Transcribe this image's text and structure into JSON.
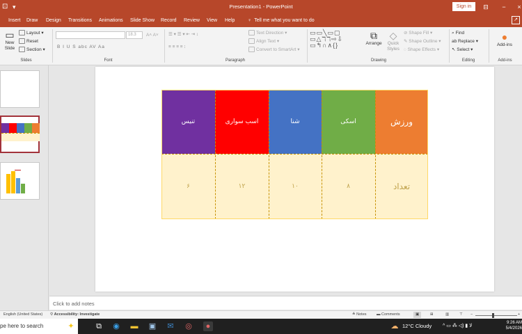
{
  "titlebar": {
    "title": "Presentation1  -  PowerPoint",
    "sign_in": "Sign in",
    "qa_icon": "caret-down-icon"
  },
  "tabs": [
    {
      "label": "Insert"
    },
    {
      "label": "Draw"
    },
    {
      "label": "Design"
    },
    {
      "label": "Transitions"
    },
    {
      "label": "Animations"
    },
    {
      "label": "Slide Show"
    },
    {
      "label": "Record"
    },
    {
      "label": "Review"
    },
    {
      "label": "View"
    },
    {
      "label": "Help"
    }
  ],
  "tell_me": "Tell me what you want to do",
  "ribbon": {
    "slides": {
      "new_slide": "New\nSlide",
      "layout": "Layout",
      "reset": "Reset",
      "section": "Section",
      "label": "Slides"
    },
    "font": {
      "size_placeholder": "18.3",
      "label": "Font",
      "styles": "B  I  U  S  abc  AV  Aa",
      "grow": "A˄ A˅"
    },
    "paragraph": {
      "text_direction": "Text Direction",
      "align_text": "Align Text",
      "convert_smartart": "Convert to SmartArt",
      "label": "Paragraph"
    },
    "drawing": {
      "arrange": "Arrange",
      "quick_styles": "Quick\nStyles",
      "shape_fill": "Shape Fill",
      "shape_outline": "Shape Outline",
      "shape_effects": "Shape Effects",
      "label": "Drawing"
    },
    "editing": {
      "find": "Find",
      "replace": "Replace",
      "select": "Select",
      "label": "Editing"
    },
    "addins": {
      "addins": "Add-ins",
      "label": "Add-ins"
    }
  },
  "slide_table": {
    "headers": [
      "تنیس",
      "اسب سواری",
      "شنا",
      "اسکی",
      "ورزش"
    ],
    "values": [
      "۶",
      "۱۲",
      "۱۰",
      "۸",
      "تعداد"
    ],
    "colors": [
      "#7030a0",
      "#ff0000",
      "#4472c4",
      "#70ad47",
      "#ed7d31"
    ],
    "body_color": "#fff2cc"
  },
  "notes": {
    "placeholder": "Click to add notes"
  },
  "statusbar": {
    "language": "English (United States)",
    "accessibility": "Accessibility: Investigate",
    "notes": "Notes",
    "comments": "Comments"
  },
  "taskbar": {
    "search": "pe here to search",
    "weather": "12°C  Cloudy",
    "time": "9:26 AM",
    "date": "5/4/2026"
  }
}
